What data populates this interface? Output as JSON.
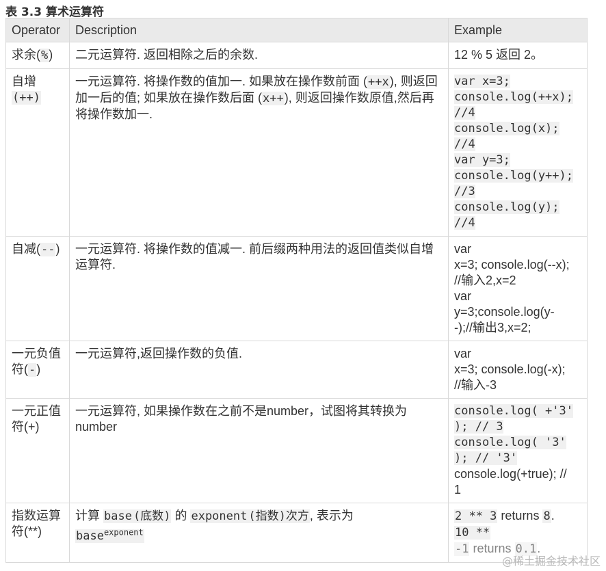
{
  "caption": "表 3.3 算术运算符",
  "headers": {
    "operator": "Operator",
    "description": "Description",
    "example": "Example"
  },
  "rows": [
    {
      "operator_text": "求余(",
      "operator_code": "%",
      "operator_tail": ")",
      "description": "二元运算符. 返回相除之后的余数.",
      "example": "12 % 5 返回 2。"
    },
    {
      "operator_text": "自增",
      "operator_code": "(++)",
      "desc_part1": "一元运算符. 将操作数的值加一. 如果放在操作数前面 (",
      "desc_code1": "++x",
      "desc_part2": "), 则返回加一后的值; 如果放在操作数后面 (",
      "desc_code2": "x++",
      "desc_part3": "), 则返回操作数原值,然后再将操作数加一.",
      "example_lines": [
        "var x=3;",
        "console.log(++x);",
        "//4",
        "console.log(x);",
        "//4",
        "var y=3;",
        "console.log(y++);",
        "//3",
        "console.log(y);",
        "//4"
      ]
    },
    {
      "operator_text": "自减(",
      "operator_code": "--",
      "operator_tail": ")",
      "description": "一元运算符. 将操作数的值减一. 前后缀两种用法的返回值类似自增运算符.",
      "example": "var\nx=3; console.log(--x);\n//输入2,x=2\nvar\ny=3;console.log(y-\n-);//输出3,x=2;"
    },
    {
      "operator_text": "一元负值符(",
      "operator_code": "-",
      "operator_tail": ")",
      "description": "一元运算符,返回操作数的负值.",
      "example": "var\nx=3; console.log(-x);\n//输入-3"
    },
    {
      "operator_text": "一元正值符(+)",
      "description": "一元运算符, 如果操作数在之前不是number，试图将其转换为number",
      "example_code": [
        "console.log( +'3'",
        "); // 3",
        "console.log( '3'",
        "); // '3'"
      ],
      "example_tail": "console.log(+true); //\n1"
    },
    {
      "operator_text": "指数运算符(**)",
      "desc_part1": "计算 ",
      "desc_code1": "base",
      "desc_code2": "(底数)",
      "desc_part2": " 的 ",
      "desc_code3": "exponent",
      "desc_code4": "(指数)次方",
      "desc_part3": ", 表示为",
      "desc_base": "base",
      "desc_sup": "exponent",
      "ex_code1": "2 ** 3",
      "ex_text1": " returns ",
      "ex_code2": "8",
      "ex_text2": ".",
      "ex_code3": "10 **",
      "ex_code4": "-1",
      "ex_text3": " returns ",
      "ex_code5": "0.1",
      "ex_text4": "."
    }
  ],
  "watermark": "@稀土掘金技术社区"
}
